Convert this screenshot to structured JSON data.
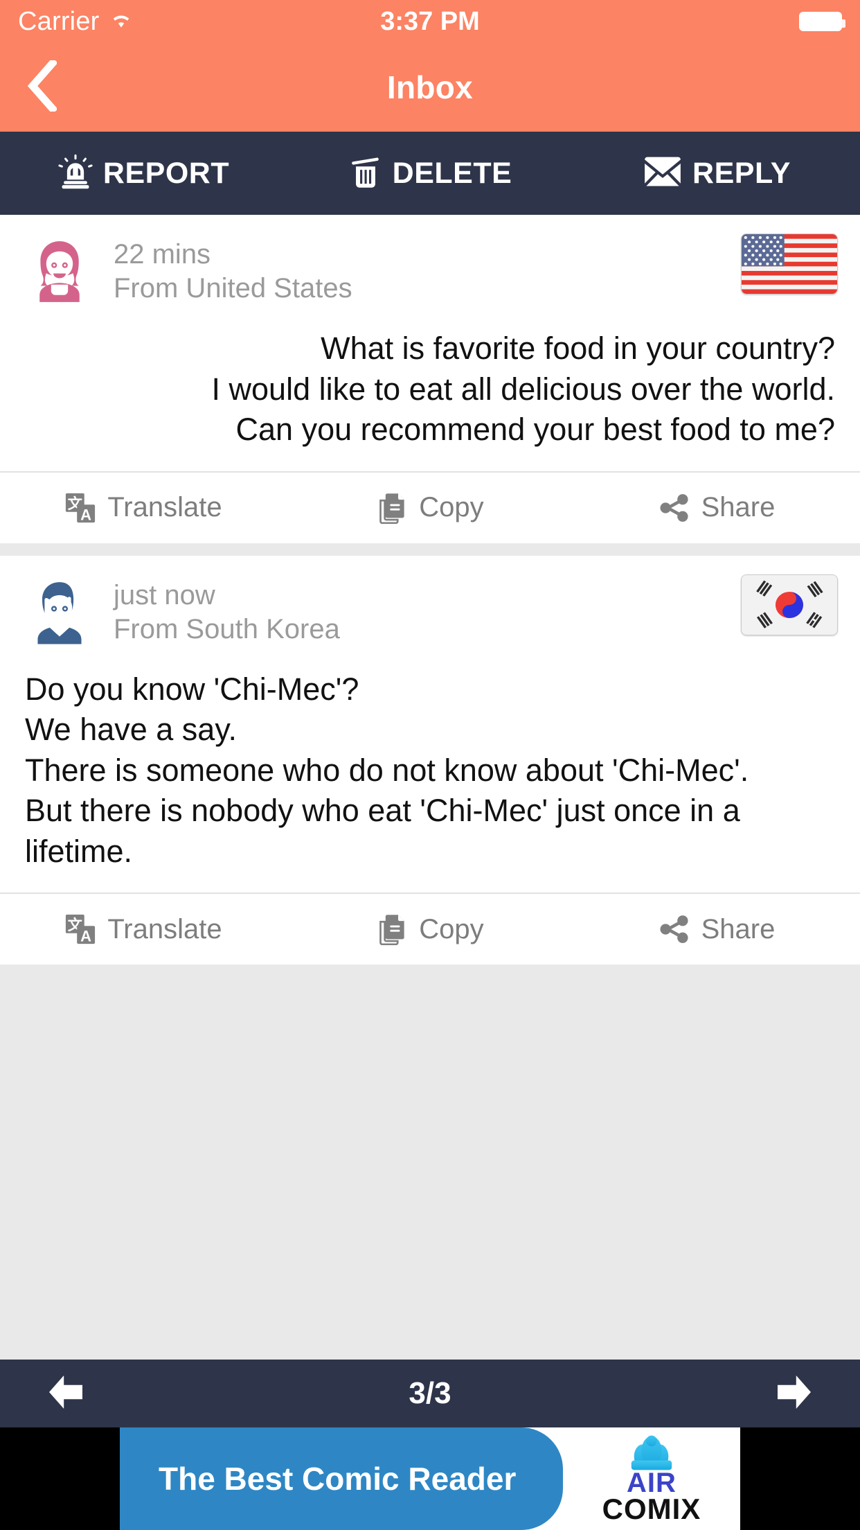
{
  "status_bar": {
    "carrier": "Carrier",
    "wifi_icon": "wifi-icon",
    "time": "3:37 PM",
    "battery_icon": "battery-full-icon"
  },
  "nav": {
    "back_icon": "chevron-left-icon",
    "title": "Inbox"
  },
  "toolbar": {
    "report_label": "REPORT",
    "report_icon": "siren-icon",
    "delete_label": "DELETE",
    "delete_icon": "trash-icon",
    "reply_label": "REPLY",
    "reply_icon": "envelope-icon"
  },
  "messages": [
    {
      "avatar_icon": "female-avatar-icon",
      "time": "22 mins",
      "from": "From United States",
      "flag_icon": "flag-united-states",
      "text": "What is favorite food in your country?\nI would like to eat all delicious over the world.\nCan you recommend your best food to me?",
      "align": "right",
      "actions": {
        "translate_label": "Translate",
        "translate_icon": "translate-icon",
        "copy_label": "Copy",
        "copy_icon": "copy-document-icon",
        "share_label": "Share",
        "share_icon": "share-nodes-icon"
      }
    },
    {
      "avatar_icon": "male-avatar-icon",
      "time": "just now",
      "from": "From South Korea",
      "flag_icon": "flag-south-korea",
      "text": "Do you know 'Chi-Mec'?\nWe have a say.\nThere is someone who do not know about 'Chi-Mec'.\nBut there is nobody who eat 'Chi-Mec' just once in a lifetime.",
      "align": "left",
      "actions": {
        "translate_label": "Translate",
        "translate_icon": "translate-icon",
        "copy_label": "Copy",
        "copy_icon": "copy-document-icon",
        "share_label": "Share",
        "share_icon": "share-nodes-icon"
      }
    }
  ],
  "pager": {
    "prev_icon": "arrow-left-icon",
    "next_icon": "arrow-right-icon",
    "count": "3/3"
  },
  "ad": {
    "headline": "The Best Comic Reader",
    "brand_top": "AIR",
    "brand_bottom": "COMIX",
    "rocket_icon": "rocket-icon"
  },
  "colors": {
    "accent_orange": "#fc8363",
    "toolbar_dark": "#2e3449",
    "page_bg": "#e9e9e9",
    "muted_text": "#9a9a9a",
    "ad_blue": "#2e87c4"
  }
}
